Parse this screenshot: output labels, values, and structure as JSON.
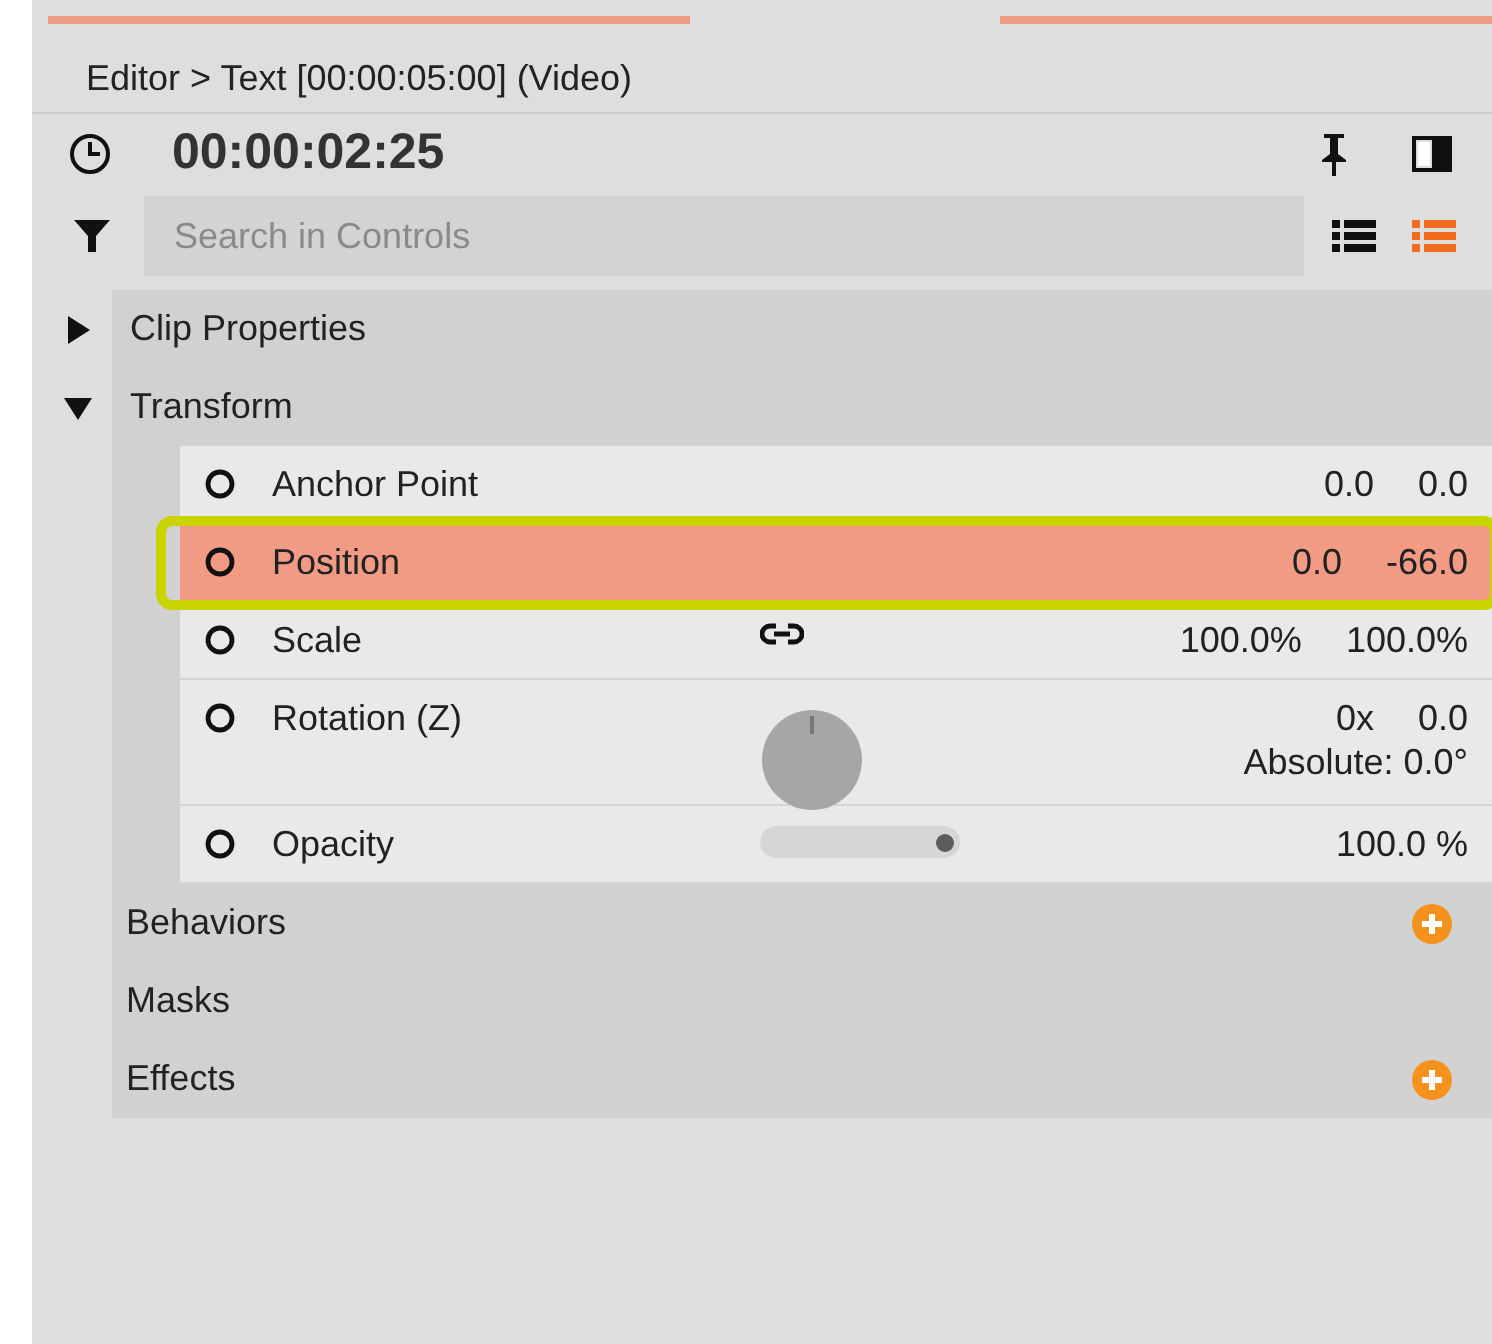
{
  "breadcrumb": "Editor > Text [00:00:05:00] (Video)",
  "timecode": "00:00:02:25",
  "search": {
    "placeholder": "Search in Controls"
  },
  "view_modes": [
    {
      "selected": false
    },
    {
      "selected": true
    }
  ],
  "groups": [
    {
      "label": "Clip Properties",
      "expanded": false
    },
    {
      "label": "Transform",
      "expanded": true,
      "properties": [
        {
          "kind": "pair",
          "label": "Anchor Point",
          "selected": false,
          "values": [
            "0.0",
            "0.0"
          ]
        },
        {
          "kind": "pair",
          "label": "Position",
          "selected": true,
          "values": [
            "0.0",
            "-66.0"
          ]
        },
        {
          "kind": "linked-pair",
          "label": "Scale",
          "selected": false,
          "values": [
            "100.0%",
            "100.0%"
          ]
        },
        {
          "kind": "rotation",
          "label": "Rotation (Z)",
          "selected": false,
          "values": [
            "0x",
            "0.0"
          ],
          "note": "Absolute: 0.0°"
        },
        {
          "kind": "slider",
          "label": "Opacity",
          "selected": false,
          "level": 0.97,
          "values": [
            "100.0 %"
          ]
        }
      ]
    }
  ],
  "sections": [
    {
      "label": "Behaviors",
      "addable": true
    },
    {
      "label": "Masks",
      "addable": false
    },
    {
      "label": "Effects",
      "addable": true
    }
  ]
}
